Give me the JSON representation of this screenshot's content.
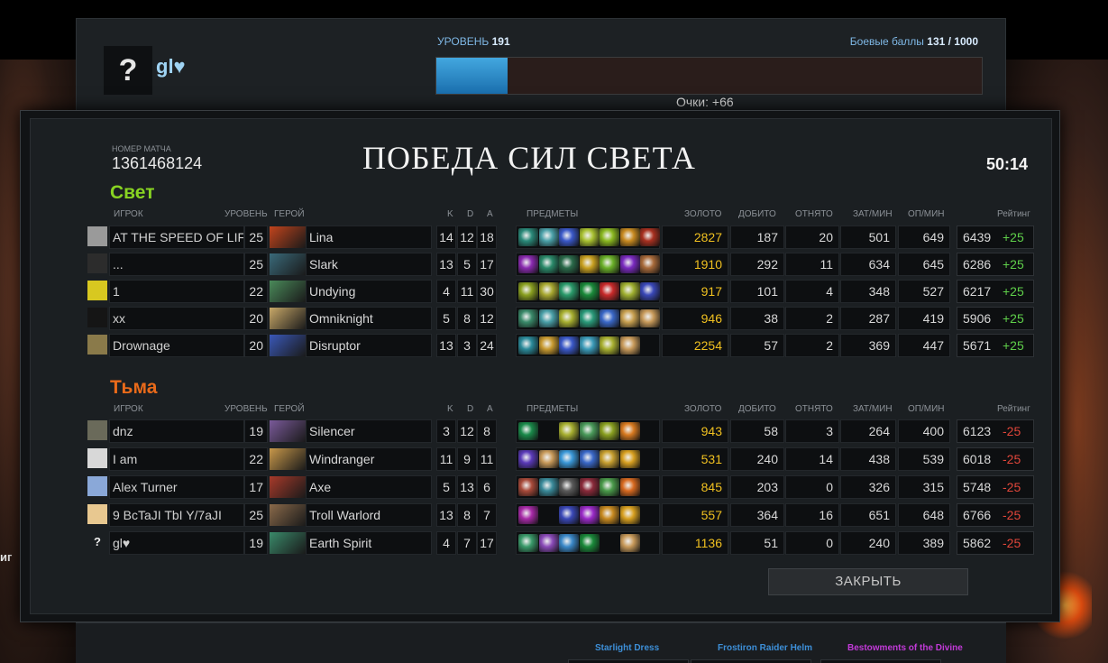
{
  "progression": {
    "avatar_glyph": "?",
    "player_name": "gl♥",
    "level_label": "УРОВЕНЬ",
    "level": "191",
    "battle_points_label": "Боевые баллы",
    "battle_points": "131 / 1000",
    "level_progress_fraction": 0.13,
    "points_text": "Очки: +66"
  },
  "match": {
    "match_number_label": "НОМЕР МАТЧА",
    "match_number": "1361468124",
    "title": "ПОБЕДА СИЛ СВЕТА",
    "duration": "50:14",
    "close_button": "ЗАКРЫТЬ"
  },
  "headers": {
    "player": "ИГРОК",
    "level": "УРОВЕНЬ",
    "hero": "ГЕРОЙ",
    "k": "K",
    "d": "D",
    "a": "A",
    "items": "ПРЕДМЕТЫ",
    "gold": "ЗОЛОТО",
    "last_hits": "ДОБИТО",
    "denies": "ОТНЯТО",
    "gpm": "ЗАТ/МИН",
    "xpm": "ОП/МИН",
    "rating": "Рейтинг"
  },
  "teams": [
    {
      "name": "Свет",
      "players": [
        {
          "name": "AT THE SPEED OF LIFE",
          "level": "25",
          "hero": "Lina",
          "k": "14",
          "d": "12",
          "a": "18",
          "gold": "2827",
          "lh": "187",
          "dn": "20",
          "gpm": "501",
          "xpm": "649",
          "rating": "6439",
          "delta": "+25",
          "hero_color": "#c2441c",
          "avatar_color": "#9a9a9a",
          "items": [
            "#2a8a7a",
            "#4aa0a8",
            "#3a58c8",
            "#a8c030",
            "#8ab820",
            "#c88a20",
            "#a83020"
          ]
        },
        {
          "name": "...",
          "level": "25",
          "hero": "Slark",
          "k": "13",
          "d": "5",
          "a": "17",
          "gold": "1910",
          "lh": "292",
          "dn": "11",
          "gpm": "634",
          "xpm": "645",
          "rating": "6286",
          "delta": "+25",
          "hero_color": "#3a6a7a",
          "avatar_color": "#2c2c2c",
          "items": [
            "#8a2ab0",
            "#2a8a6a",
            "#2a6a4a",
            "#c8a020",
            "#6ab028",
            "#7a2ac0",
            "#a86a3a"
          ]
        },
        {
          "name": "1",
          "level": "22",
          "hero": "Undying",
          "k": "4",
          "d": "11",
          "a": "30",
          "gold": "917",
          "lh": "101",
          "dn": "4",
          "gpm": "348",
          "xpm": "527",
          "rating": "6217",
          "delta": "+25",
          "hero_color": "#4a8a5a",
          "avatar_color": "#d8c820",
          "items": [
            "#8aa020",
            "#a8a830",
            "#2a9a6a",
            "#1a8a3a",
            "#c82a2a",
            "#a0b030",
            "#3a48b8"
          ]
        },
        {
          "name": "xx",
          "level": "20",
          "hero": "Omniknight",
          "k": "5",
          "d": "8",
          "a": "12",
          "gold": "946",
          "lh": "38",
          "dn": "2",
          "gpm": "287",
          "xpm": "419",
          "rating": "5906",
          "delta": "+25",
          "hero_color": "#c8a868",
          "avatar_color": "#151515",
          "items": [
            "#3a8a6a",
            "#4aa0a8",
            "#a8b030",
            "#2a9a7a",
            "#3a68c8",
            "#c8a050",
            "#c89a5a"
          ]
        },
        {
          "name": "Drownage",
          "level": "20",
          "hero": "Disruptor",
          "k": "13",
          "d": "3",
          "a": "24",
          "gold": "2254",
          "lh": "57",
          "dn": "2",
          "gpm": "369",
          "xpm": "447",
          "rating": "5671",
          "delta": "+25",
          "hero_color": "#3a58b8",
          "avatar_color": "#8a7a4a",
          "items": [
            "#2a8a9a",
            "#c89a30",
            "#3a58c8",
            "#3a9ab8",
            "#a8b030",
            "#c89a5a",
            "#1b1f22"
          ]
        }
      ]
    },
    {
      "name": "Тьма",
      "players": [
        {
          "name": "dnz",
          "level": "19",
          "hero": "Silencer",
          "k": "3",
          "d": "12",
          "a": "8",
          "gold": "943",
          "lh": "58",
          "dn": "3",
          "gpm": "264",
          "xpm": "400",
          "rating": "6123",
          "delta": "-25",
          "hero_color": "#7a5a9a",
          "avatar_color": "#6a6a5a",
          "items": [
            "#1a8a4a",
            "#1b1f22",
            "#a8b030",
            "#4a9a5a",
            "#8aa020",
            "#d87a20",
            "#1b1f22"
          ]
        },
        {
          "name": "I am",
          "level": "22",
          "hero": "Windranger",
          "k": "11",
          "d": "9",
          "a": "11",
          "gold": "531",
          "lh": "240",
          "dn": "14",
          "gpm": "438",
          "xpm": "539",
          "rating": "6018",
          "delta": "-25",
          "hero_color": "#c8984a",
          "avatar_color": "#d8d8d8",
          "items": [
            "#5a3ab8",
            "#c89a5a",
            "#3a98d8",
            "#3a68c8",
            "#c8a030",
            "#d8a020",
            "#1b1f22"
          ]
        },
        {
          "name": "Alex Turner",
          "level": "17",
          "hero": "Axe",
          "k": "5",
          "d": "13",
          "a": "6",
          "gold": "845",
          "lh": "203",
          "dn": "0",
          "gpm": "326",
          "xpm": "315",
          "rating": "5748",
          "delta": "-25",
          "hero_color": "#a83a2a",
          "avatar_color": "#8aa8d8",
          "items": [
            "#a84a3a",
            "#3a8a9a",
            "#5a5a5a",
            "#8a2a3a",
            "#4a9a4a",
            "#d86a20",
            "#1b1f22"
          ]
        },
        {
          "name": "9 BcTaJI TbI Y/7aJI",
          "level": "25",
          "hero": "Troll Warlord",
          "k": "13",
          "d": "8",
          "a": "7",
          "gold": "557",
          "lh": "364",
          "dn": "16",
          "gpm": "651",
          "xpm": "648",
          "rating": "6766",
          "delta": "-25",
          "hero_color": "#8a6a4a",
          "avatar_color": "#e8c890",
          "items": [
            "#a82aa8",
            "#1b1f22",
            "#3a48b8",
            "#9a2ac8",
            "#c88a20",
            "#d8a020",
            "#1b1f22"
          ]
        },
        {
          "name": "gl♥",
          "level": "19",
          "hero": "Earth Spirit",
          "k": "4",
          "d": "7",
          "a": "17",
          "gold": "1136",
          "lh": "51",
          "dn": "0",
          "gpm": "240",
          "xpm": "389",
          "rating": "5862",
          "delta": "-25",
          "hero_color": "#3a8a6a",
          "avatar_color": "#1b1f22",
          "avatar_glyph": "?",
          "items": [
            "#3a9a6a",
            "#8a4ab8",
            "#3a88c8",
            "#1a8a3a",
            "#1b1f22",
            "#c89a5a",
            "#1b1f22"
          ]
        }
      ]
    }
  ],
  "drops": [
    {
      "name": "Starlight Dress",
      "color": "#3d8fd8"
    },
    {
      "name": "Frostiron Raider Helm",
      "color": "#3d8fd8"
    },
    {
      "name": "Bestowments of the Divine",
      "color": "#c23ad8"
    }
  ],
  "background": {
    "cut_text": "иг"
  }
}
